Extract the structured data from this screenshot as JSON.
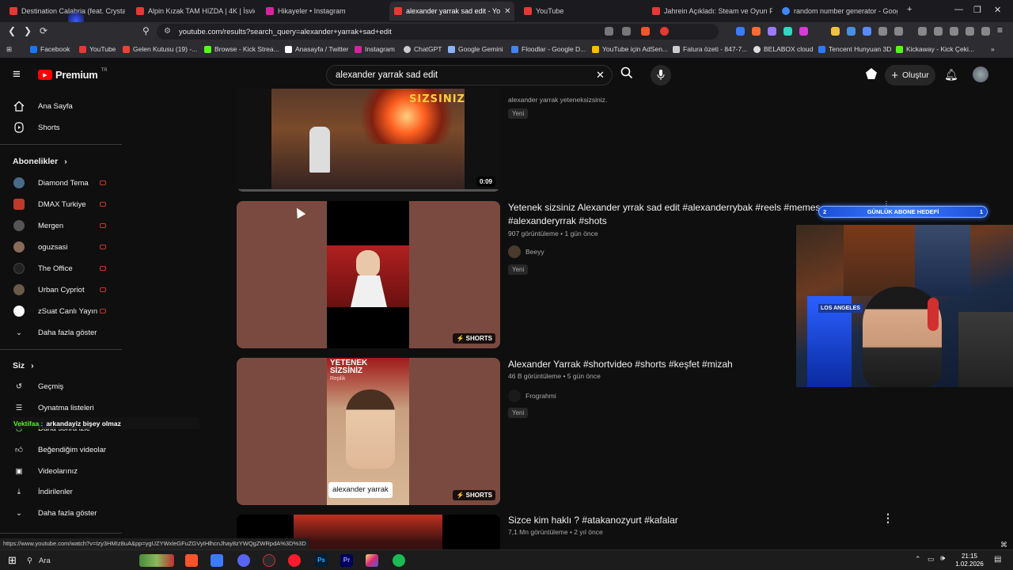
{
  "browser": {
    "tabs": [
      {
        "label": "Destination Calabria (feat. Crystal Wa",
        "color": "#e53935"
      },
      {
        "label": "Alpin Kızak TAM HIZDA | 4K | İsviçre",
        "color": "#e53935"
      },
      {
        "label": "Hikayeler • Instagram",
        "color": "#d6249f"
      },
      {
        "label": "alexander yarrak sad edit - Yo",
        "color": "#e53935"
      },
      {
        "label": "YouTube",
        "color": "#e53935"
      },
      {
        "label": "Jahrein Açıkladı: Steam ve Oyun Plat",
        "color": "#e53935"
      },
      {
        "label": "random number generator - Google",
        "color": "#4285f4"
      }
    ],
    "url": "youtube.com/results?search_query=alexander+yarrak+sad+edit",
    "bookmarks": [
      {
        "label": "Facebook",
        "color": "#1877f2"
      },
      {
        "label": "YouTube",
        "color": "#e53935"
      },
      {
        "label": "Gelen Kutusu (19) -...",
        "color": "#ea4335"
      },
      {
        "label": "Browse - Kick Strea...",
        "color": "#53fc18"
      },
      {
        "label": "Anasayfa / Twitter",
        "color": "#ffffff"
      },
      {
        "label": "Instagram",
        "color": "#d6249f"
      },
      {
        "label": "ChatGPT",
        "color": "#cccccc"
      },
      {
        "label": "Google Gemini",
        "color": "#8ab4f8"
      },
      {
        "label": "Floodlar - Google D...",
        "color": "#4285f4"
      },
      {
        "label": "YouTube için AdSen...",
        "color": "#fbbc04"
      },
      {
        "label": "Fatura özeti - 847-7...",
        "color": "#cccccc"
      },
      {
        "label": "BELABOX cloud",
        "color": "#dddddd"
      },
      {
        "label": "Tencent Hunyuan 3D",
        "color": "#2a7bff"
      },
      {
        "label": "Kickaway - Kick Çeki...",
        "color": "#53fc18"
      }
    ]
  },
  "youtube": {
    "logo_text": "Premium",
    "logo_region": "TR",
    "search_value": "alexander yarrak sad edit",
    "create_label": "Oluştur"
  },
  "sidebar": {
    "main": [
      {
        "label": "Ana Sayfa",
        "icon": "home-icon"
      },
      {
        "label": "Shorts",
        "icon": "shorts-icon"
      }
    ],
    "subs_header": "Abonelikler",
    "subs": [
      {
        "label": "Diamond Tema",
        "color": "#4a6a8a"
      },
      {
        "label": "DMAX Turkiye",
        "color": "#c0392b"
      },
      {
        "label": "Mergen",
        "color": "#555555"
      },
      {
        "label": "oguzsasi",
        "color": "#8a6a5a"
      },
      {
        "label": "The Office",
        "color": "#222222"
      },
      {
        "label": "Urban Cypriot",
        "color": "#6a5a4a"
      },
      {
        "label": "zSuat Canlı Yayın",
        "color": "#ffffff"
      }
    ],
    "more_subs": "Daha fazla göster",
    "you_header": "Siz",
    "you": [
      {
        "label": "Geçmiş",
        "icon": "history-icon"
      },
      {
        "label": "Oynatma listeleri",
        "icon": "playlist-icon"
      },
      {
        "label": "Daha sonra izle",
        "icon": "clock-icon"
      },
      {
        "label": "Beğendiğim videolar",
        "icon": "like-icon"
      },
      {
        "label": "Videolarınız",
        "icon": "video-icon"
      },
      {
        "label": "İndirilenler",
        "icon": "download-icon"
      }
    ],
    "more_you": "Daha fazla göster"
  },
  "chat_overlay": {
    "user": "Vektifaa :",
    "message": "arkandayiz bişey olmaz"
  },
  "results": [
    {
      "title": "",
      "meta": "",
      "channel": "alexander yarrak yeteneksizsiniz.",
      "badge": "0:09",
      "new_tag": "Yeni",
      "thumb_text": "SIZSINIZ"
    },
    {
      "title": "Yetenek sizsiniz Alexander yrrak sad edit #alexanderrybak #reels #memes #alexanderyrrak #shots",
      "meta": "907 görüntüleme • 1 gün önce",
      "channel": "Beeyy",
      "badge": "SHORTS",
      "new_tag": "Yeni"
    },
    {
      "title": "Alexander Yarrak #shortvideo #shorts #keşfet #mizah",
      "meta": "46 B görüntüleme • 5 gün önce",
      "channel": "Frograhmi",
      "badge": "SHORTS",
      "new_tag": "Yeni",
      "thumb_text_top": "YETENEK",
      "thumb_text_top2": "SİZSİNİZ",
      "thumb_text_sub": "Replik",
      "thumb_caption": "alexander yarrak"
    },
    {
      "title": "Sizce kim haklı ? #atakanozyurt #kafalar",
      "meta": "7,1 Mn görüntüleme • 2 yıl önce"
    }
  ],
  "overlay": {
    "goal_left": "2",
    "goal_label": "GÜNLÜK ABONE HEDEFİ",
    "goal_right": "1",
    "poster_text": "LOS ANGELES"
  },
  "status_url": "https://www.youtube.com/watch?v=Izy3HMIz8uA&pp=ygUZYWxleGFuZGVyIHlhcnJhay8zYWQgZWRpdA%3D%3D",
  "taskbar": {
    "search_label": "Ara",
    "time": "21:15",
    "date": "1.02.2026"
  }
}
